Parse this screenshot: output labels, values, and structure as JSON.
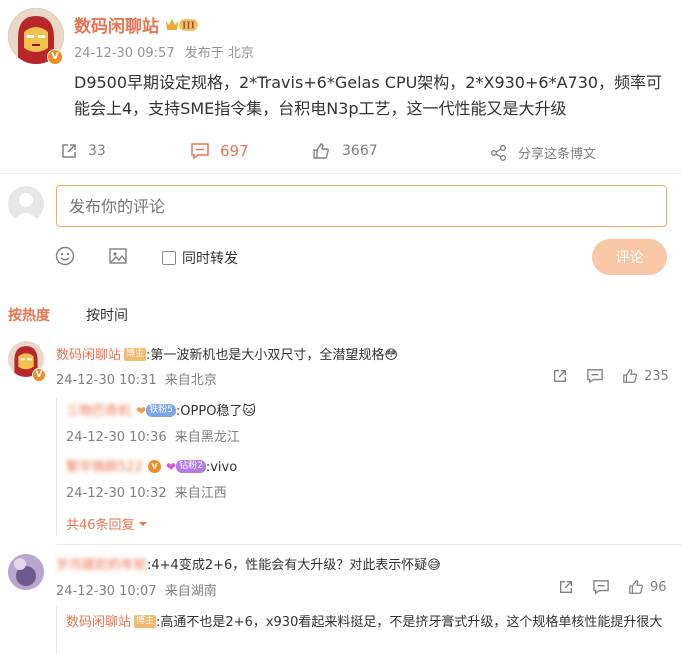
{
  "post": {
    "author": "数码闲聊站",
    "time": "24-12-30 09:57",
    "location": "发布于 北京",
    "text": "D9500早期设定规格，2*Travis+6*Gelas CPU架构，2*X930+6*A730，频率可能会上4，支持SME指令集，台积电N3p工艺，这一代性能又是大升级",
    "repost_count": "33",
    "comment_count": "697",
    "like_count": "3667",
    "share_label": "分享这条博文"
  },
  "composer": {
    "placeholder": "发布你的评论",
    "repost_checkbox_label": "同时转发",
    "submit_label": "评论"
  },
  "sort_tabs": {
    "hot": "按热度",
    "time": "按时间"
  },
  "comments": [
    {
      "author": "数码闲聊站",
      "badge": "博主",
      "text": ":第一波新机也是大小双尺寸，全潜望规格😳",
      "time": "24-12-30 10:31",
      "location": "来自北京",
      "likes": "235",
      "replies": [
        {
          "author": "三物巴奇机",
          "badge": "铁粉5",
          "text": ":OPPO稳了🐱",
          "time": "24-12-30 10:36",
          "location": "来自黑龙江"
        },
        {
          "author": "繁华锦颜522",
          "badge": "钻粉2",
          "text": ":vivo",
          "time": "24-12-30 10:32",
          "location": "来自江西"
        }
      ],
      "more_replies": "共46条回复"
    },
    {
      "author": "岁月蹉跎的年轮",
      "text": ":4+4变成2+6，性能会有大升级？对此表示怀疑😅",
      "time": "24-12-30 10:07",
      "location": "来自湖南",
      "likes": "96",
      "replies": [
        {
          "author": "数码闲聊站",
          "badge": "博主",
          "text": ":高通不也是2+6，x930看起来料挺足，不是挤牙膏式升级，这个规格单核性能提升很大"
        }
      ]
    }
  ],
  "colors": {
    "accent": "#eb7350",
    "button_disabled": "#f9c7a6",
    "muted": "#939393"
  }
}
